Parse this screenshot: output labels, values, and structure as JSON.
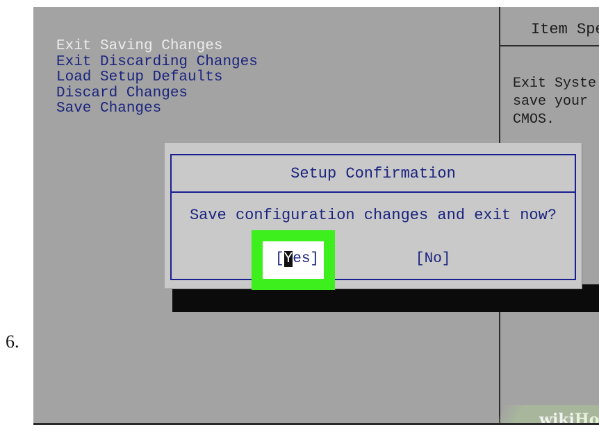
{
  "step": {
    "number": "6."
  },
  "menu": {
    "items": [
      "Exit Saving Changes",
      "Exit Discarding Changes",
      "Load Setup Defaults",
      "Discard Changes",
      "Save Changes"
    ],
    "selected_index": 0
  },
  "help_panel": {
    "title": "Item Spe",
    "lines": [
      "Exit Syste",
      "save your",
      "CMOS."
    ]
  },
  "dialog": {
    "title": "Setup Confirmation",
    "message": "Save configuration changes and exit now?",
    "yes_prefix": "[",
    "yes_caret": "Y",
    "yes_rest": "es]",
    "no_label": "[No]"
  },
  "watermark": {
    "wiki": "wiki",
    "how": "How"
  },
  "colors": {
    "bios_background": "#a3a3a3",
    "menu_text": "#1a237e",
    "selected_text": "#ececec",
    "highlight": "#3cef1d"
  }
}
